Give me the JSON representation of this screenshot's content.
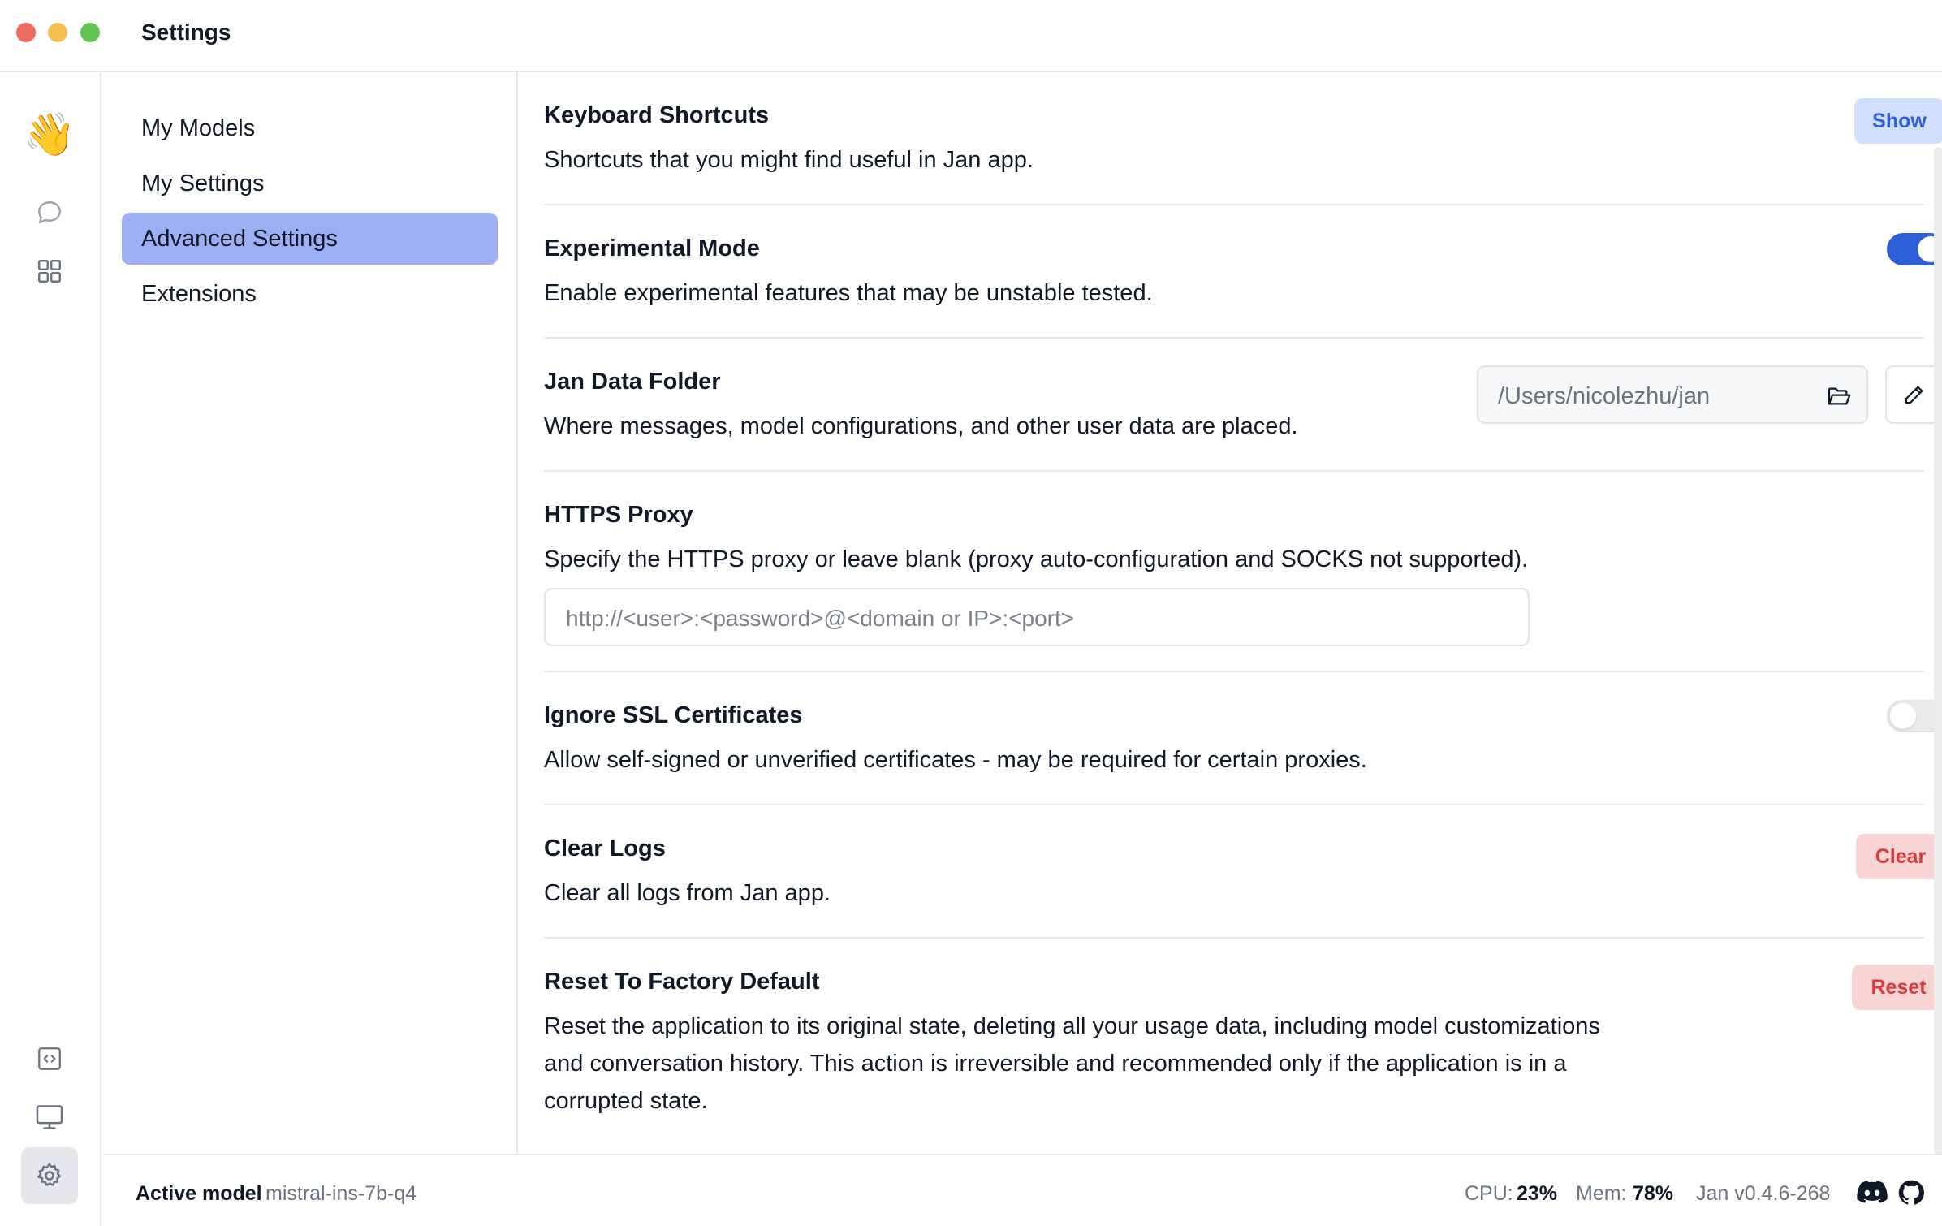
{
  "window": {
    "title": "Settings"
  },
  "nav": {
    "items": [
      {
        "label": "My Models"
      },
      {
        "label": "My Settings"
      },
      {
        "label": "Advanced Settings",
        "active": true
      },
      {
        "label": "Extensions"
      }
    ]
  },
  "sections": {
    "keyboard": {
      "title": "Keyboard Shortcuts",
      "desc": "Shortcuts that you might find useful in Jan app.",
      "button": "Show"
    },
    "experimental": {
      "title": "Experimental Mode",
      "desc": "Enable experimental features that may be unstable tested.",
      "enabled": true
    },
    "data_folder": {
      "title": "Jan Data Folder",
      "desc": "Where messages, model configurations, and other user data are placed.",
      "path": "/Users/nicolezhu/jan"
    },
    "proxy": {
      "title": "HTTPS Proxy",
      "desc": "Specify the HTTPS proxy or leave blank (proxy auto-configuration and SOCKS not supported).",
      "placeholder": "http://<user>:<password>@<domain or IP>:<port>",
      "value": ""
    },
    "ssl": {
      "title": "Ignore SSL Certificates",
      "desc": "Allow self-signed or unverified certificates - may be required for certain proxies.",
      "enabled": false
    },
    "logs": {
      "title": "Clear Logs",
      "desc": "Clear all logs from Jan app.",
      "button": "Clear"
    },
    "reset": {
      "title": "Reset To Factory Default",
      "desc_lines": [
        "Reset the application to its original state, deleting all your usage data, including model customizations",
        "and conversation history. This action is irreversible and recommended only if the application is in a",
        "corrupted state."
      ],
      "button": "Reset"
    }
  },
  "status": {
    "active_model_label": "Active model",
    "active_model": "mistral-ins-7b-q4",
    "cpu_label": "CPU:",
    "cpu_value": "23%",
    "mem_label": "Mem:",
    "mem_value": "78%",
    "version": "Jan v0.4.6-268"
  },
  "icons": {
    "rail": [
      "wave-logo-icon",
      "chat-icon",
      "grid-icon",
      "code-icon",
      "monitor-icon",
      "settings-gear-icon"
    ],
    "status": [
      "discord-icon",
      "github-icon"
    ]
  },
  "colors": {
    "accent": "#2f5fd8",
    "nav_active": "#9caff2",
    "danger": "#d83b3b"
  }
}
